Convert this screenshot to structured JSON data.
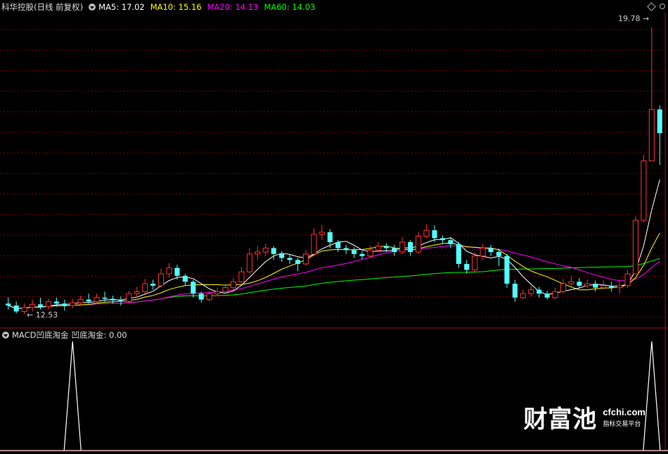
{
  "header": {
    "stock_title": "科华控股(日线 前复权)",
    "ma5_label": "MA5: 17.02",
    "ma10_label": "MA10: 15.16",
    "ma20_label": "MA20: 14.13",
    "ma60_label": "MA60: 14.03"
  },
  "indicator": {
    "title": "MACD凹底淘金",
    "value_label": "凹底淘金: 0.00"
  },
  "annotations": {
    "high_label": "19.78",
    "low_label": "12.53"
  },
  "watermark": {
    "brand": "财富池",
    "domain": "cfchi.com",
    "slogan": "指标交易平台"
  },
  "colors": {
    "up": "#ff3232",
    "down": "#54ffff",
    "ma5": "#ffffff",
    "ma10": "#ffff00",
    "ma20": "#ff00ff",
    "ma60": "#00ff00",
    "grid": "#7a0000",
    "background": "#000000"
  },
  "chart_data": [
    {
      "type": "candlestick",
      "title": "科华控股(日线 前复权)",
      "ylim": [
        12.2,
        20.0
      ],
      "high": 19.78,
      "low": 12.53,
      "candles": [
        [
          12.8,
          12.75,
          12.95,
          12.65
        ],
        [
          12.75,
          12.6,
          12.85,
          12.55
        ],
        [
          12.6,
          12.7,
          12.8,
          12.53
        ],
        [
          12.7,
          12.78,
          12.9,
          12.6
        ],
        [
          12.78,
          12.72,
          12.95,
          12.65
        ],
        [
          12.72,
          12.85,
          12.92,
          12.65
        ],
        [
          12.85,
          12.8,
          12.95,
          12.72
        ],
        [
          12.8,
          12.75,
          12.9,
          12.62
        ],
        [
          12.75,
          12.82,
          12.92,
          12.68
        ],
        [
          12.82,
          12.9,
          13.0,
          12.75
        ],
        [
          12.9,
          12.85,
          13.05,
          12.8
        ],
        [
          12.85,
          12.95,
          13.05,
          12.8
        ],
        [
          12.95,
          12.92,
          13.1,
          12.85
        ],
        [
          12.92,
          12.88,
          13.0,
          12.8
        ],
        [
          12.88,
          12.85,
          12.98,
          12.75
        ],
        [
          12.85,
          13.05,
          13.12,
          12.8
        ],
        [
          13.05,
          13.1,
          13.22,
          12.98
        ],
        [
          13.1,
          13.3,
          13.42,
          13.05
        ],
        [
          13.3,
          13.25,
          13.4,
          13.15
        ],
        [
          13.25,
          13.55,
          13.68,
          13.2
        ],
        [
          13.55,
          13.7,
          13.82,
          13.45
        ],
        [
          13.7,
          13.5,
          13.78,
          13.4
        ],
        [
          13.5,
          13.35,
          13.55,
          13.25
        ],
        [
          13.35,
          13.05,
          13.4,
          12.95
        ],
        [
          13.05,
          12.9,
          13.1,
          12.82
        ],
        [
          12.9,
          13.05,
          13.12,
          12.85
        ],
        [
          13.05,
          13.1,
          13.2,
          13.0
        ],
        [
          13.1,
          13.2,
          13.3,
          13.05
        ],
        [
          13.2,
          13.35,
          13.45,
          13.15
        ],
        [
          13.35,
          13.6,
          13.72,
          13.3
        ],
        [
          13.6,
          14.05,
          14.2,
          13.55
        ],
        [
          14.05,
          14.1,
          14.25,
          13.9
        ],
        [
          14.1,
          14.2,
          14.32,
          14.0
        ],
        [
          14.2,
          14.05,
          14.25,
          13.9
        ],
        [
          14.05,
          13.95,
          14.12,
          13.85
        ],
        [
          13.95,
          13.9,
          14.05,
          13.8
        ],
        [
          13.9,
          13.8,
          13.95,
          13.62
        ],
        [
          13.8,
          14.05,
          14.15,
          13.75
        ],
        [
          14.05,
          14.55,
          14.7,
          14.0
        ],
        [
          14.55,
          14.6,
          14.78,
          14.4
        ],
        [
          14.6,
          14.35,
          14.68,
          14.2
        ],
        [
          14.35,
          14.2,
          14.4,
          14.1
        ],
        [
          14.2,
          14.15,
          14.28,
          14.05
        ],
        [
          14.15,
          14.05,
          14.22,
          13.95
        ],
        [
          14.05,
          14.0,
          14.12,
          13.92
        ],
        [
          14.0,
          14.15,
          14.25,
          13.95
        ],
        [
          14.15,
          14.25,
          14.35,
          14.1
        ],
        [
          14.25,
          14.2,
          14.32,
          14.1
        ],
        [
          14.2,
          14.1,
          14.28,
          14.0
        ],
        [
          14.1,
          14.35,
          14.48,
          14.05
        ],
        [
          14.35,
          14.1,
          14.4,
          14.0
        ],
        [
          14.1,
          14.5,
          14.6,
          14.05
        ],
        [
          14.5,
          14.65,
          14.8,
          14.45
        ],
        [
          14.65,
          14.45,
          14.78,
          14.35
        ],
        [
          14.45,
          14.4,
          14.52,
          14.3
        ],
        [
          14.4,
          14.3,
          14.48,
          14.2
        ],
        [
          14.3,
          13.8,
          14.35,
          13.7
        ],
        [
          13.8,
          13.65,
          13.9,
          13.55
        ],
        [
          13.65,
          14.0,
          14.1,
          13.6
        ],
        [
          14.0,
          14.2,
          14.3,
          13.9
        ],
        [
          14.2,
          14.1,
          14.28,
          14.0
        ],
        [
          14.1,
          14.0,
          14.18,
          13.75
        ],
        [
          14.0,
          13.3,
          14.05,
          13.2
        ],
        [
          13.3,
          12.95,
          13.4,
          12.85
        ],
        [
          12.95,
          13.05,
          13.15,
          12.9
        ],
        [
          13.05,
          13.15,
          13.25,
          12.98
        ],
        [
          13.15,
          13.05,
          13.22,
          12.95
        ],
        [
          13.05,
          12.95,
          13.12,
          12.9
        ],
        [
          12.95,
          13.1,
          13.2,
          12.9
        ],
        [
          13.1,
          13.3,
          13.42,
          13.05
        ],
        [
          13.3,
          13.35,
          13.48,
          13.25
        ],
        [
          13.35,
          13.25,
          13.45,
          13.18
        ],
        [
          13.25,
          13.3,
          13.4,
          13.2
        ],
        [
          13.3,
          13.2,
          13.38,
          13.1
        ],
        [
          13.2,
          13.25,
          13.38,
          13.15
        ],
        [
          13.25,
          13.2,
          13.35,
          13.1
        ],
        [
          13.2,
          13.25,
          13.4,
          13.05
        ],
        [
          13.25,
          13.55,
          13.65,
          13.2
        ],
        [
          13.55,
          14.9,
          15.0,
          13.55
        ],
        [
          14.9,
          16.4,
          16.55,
          14.85
        ],
        [
          16.4,
          17.7,
          19.78,
          16.4
        ],
        [
          17.7,
          17.1,
          17.8,
          16.3
        ]
      ]
    },
    {
      "type": "line",
      "title": "MACD凹底淘金",
      "series": [
        {
          "name": "凹底淘金",
          "current": 0.0
        }
      ],
      "signal_indices": [
        8,
        80
      ]
    }
  ]
}
